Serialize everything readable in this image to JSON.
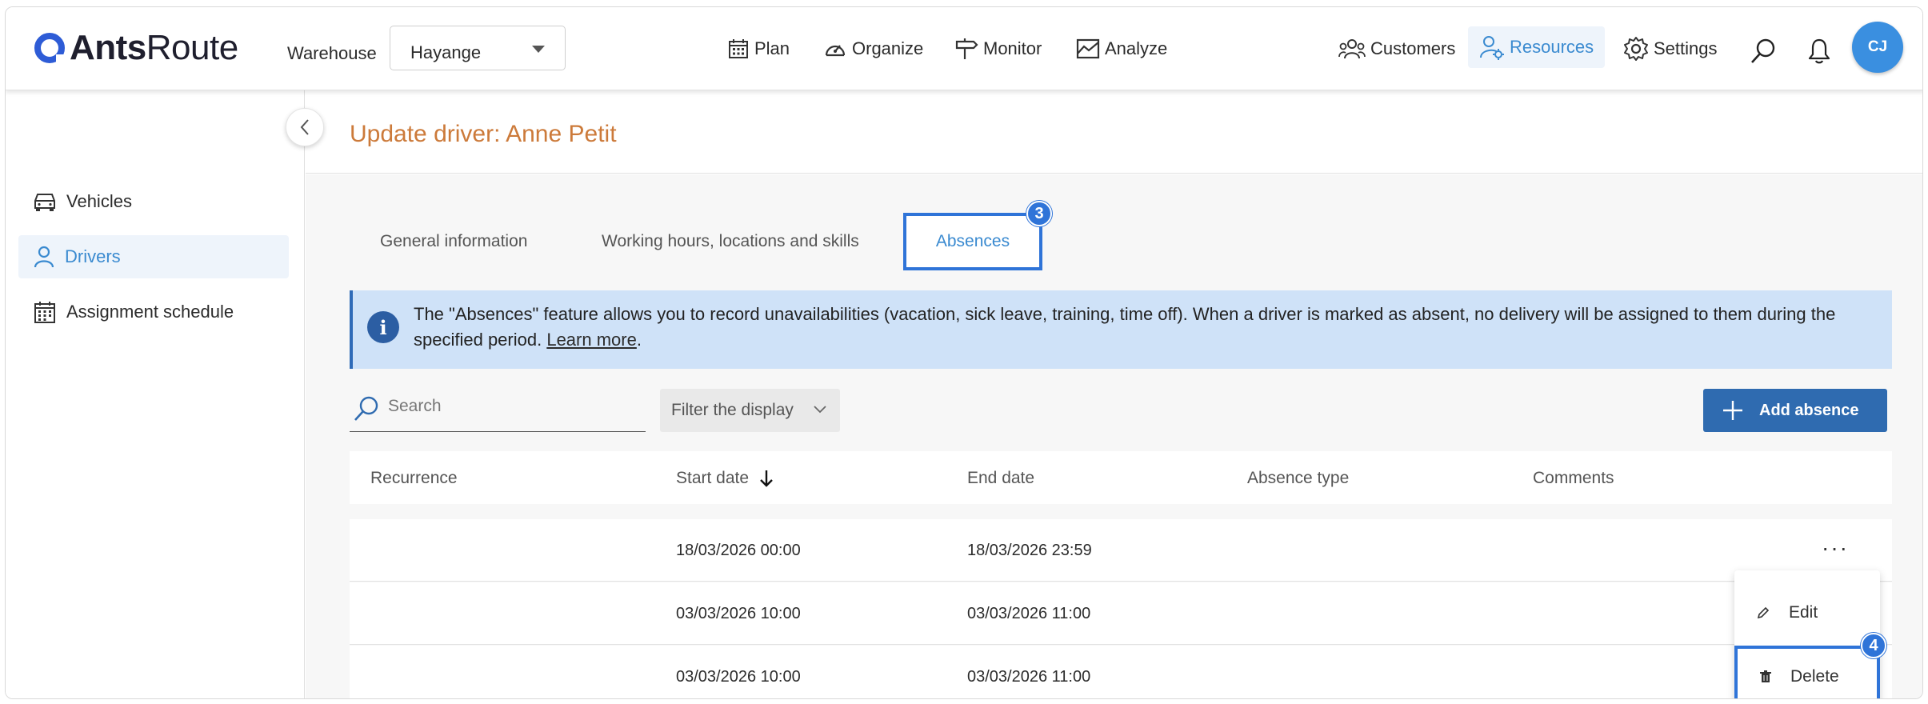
{
  "header": {
    "logo": {
      "bold": "Ants",
      "light": "Route"
    },
    "warehouse_label": "Warehouse",
    "warehouse_value": "Hayange",
    "nav": [
      {
        "label": "Plan",
        "icon": "calendar-icon"
      },
      {
        "label": "Organize",
        "icon": "gauge-icon"
      },
      {
        "label": "Monitor",
        "icon": "signpost-icon"
      },
      {
        "label": "Analyze",
        "icon": "chart-icon"
      }
    ],
    "right_nav": [
      {
        "label": "Customers",
        "icon": "users-icon"
      },
      {
        "label": "Resources",
        "icon": "resources-icon",
        "active": true
      },
      {
        "label": "Settings",
        "icon": "gear-icon"
      }
    ],
    "avatar_initials": "CJ"
  },
  "sidebar": {
    "items": [
      {
        "label": "Vehicles",
        "icon": "car-icon"
      },
      {
        "label": "Drivers",
        "icon": "person-icon",
        "active": true
      },
      {
        "label": "Assignment schedule",
        "icon": "calendar-grid-icon"
      }
    ]
  },
  "page": {
    "title": "Update driver: Anne Petit"
  },
  "tabs": [
    {
      "label": "General information"
    },
    {
      "label": "Working hours, locations and skills"
    },
    {
      "label": "Absences",
      "active": true
    }
  ],
  "step_badges": {
    "tab": "3",
    "menu": "4"
  },
  "info": {
    "text": "The \"Absences\" feature allows you to record unavailabilities (vacation, sick leave, training, time off). When a driver is marked as absent, no delivery will be assigned to them during the specified period. ",
    "link": "Learn more",
    "after_link": "."
  },
  "toolbar": {
    "search_placeholder": "Search",
    "filter_label": "Filter the display",
    "add_label": "Add absence"
  },
  "table": {
    "columns": [
      "Recurrence",
      "Start date",
      "End date",
      "Absence type",
      "Comments"
    ],
    "sort_column": "Start date",
    "rows": [
      {
        "recurrence": "",
        "start": "18/03/2026 00:00",
        "end": "18/03/2026 23:59",
        "type": "",
        "comments": ""
      },
      {
        "recurrence": "",
        "start": "03/03/2026 10:00",
        "end": "03/03/2026 11:00",
        "type": "",
        "comments": ""
      },
      {
        "recurrence": "",
        "start": "03/03/2026 10:00",
        "end": "03/03/2026 11:00",
        "type": "",
        "comments": ""
      }
    ]
  },
  "context_menu": {
    "edit_label": "Edit",
    "delete_label": "Delete"
  },
  "colors": {
    "accent": "#2f74d8",
    "primary_button": "#2f6bb0",
    "title": "#cc7a3a",
    "info_bg": "#cfe2f8"
  }
}
